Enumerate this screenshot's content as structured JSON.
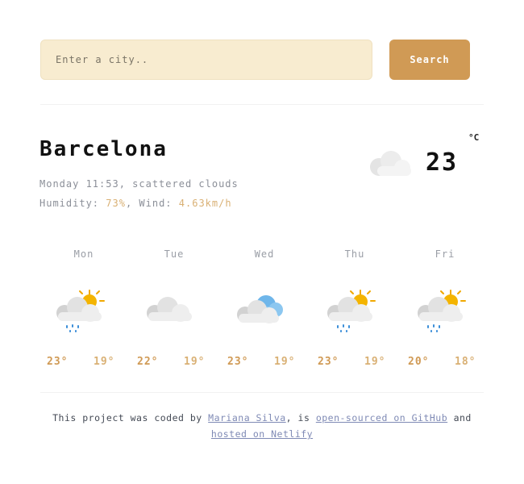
{
  "search": {
    "placeholder": "Enter a city..",
    "button_label": "Search"
  },
  "current": {
    "city": "Barcelona",
    "day_time": "Monday 11:53",
    "description": "scattered clouds",
    "humidity_label": "Humidity:",
    "humidity_value": "73%",
    "wind_label": "Wind:",
    "wind_value": "4.63km/h",
    "temperature": "23",
    "unit": "°C",
    "icon": "cloud-icon"
  },
  "forecast": [
    {
      "day": "Mon",
      "max": "23°",
      "min": "19°",
      "icon": "sun-cloud-rain-icon"
    },
    {
      "day": "Tue",
      "max": "22°",
      "min": "19°",
      "icon": "cloud-icon"
    },
    {
      "day": "Wed",
      "max": "23°",
      "min": "19°",
      "icon": "cloudy-icon"
    },
    {
      "day": "Thu",
      "max": "23°",
      "min": "19°",
      "icon": "sun-cloud-rain-icon"
    },
    {
      "day": "Fri",
      "max": "20°",
      "min": "18°",
      "icon": "sun-cloud-rain-icon"
    }
  ],
  "footer": {
    "text1": "This project was coded by",
    "author_link": "Mariana Silva",
    "text2": ", is",
    "github_link": "open-sourced on GitHub",
    "text3": "and",
    "netlify_link": "hosted on Netlify"
  },
  "colors": {
    "accent": "#d09a55",
    "accent_light": "#d9b074",
    "input_bg": "#f8ecd0",
    "link": "#7f8ab5"
  }
}
